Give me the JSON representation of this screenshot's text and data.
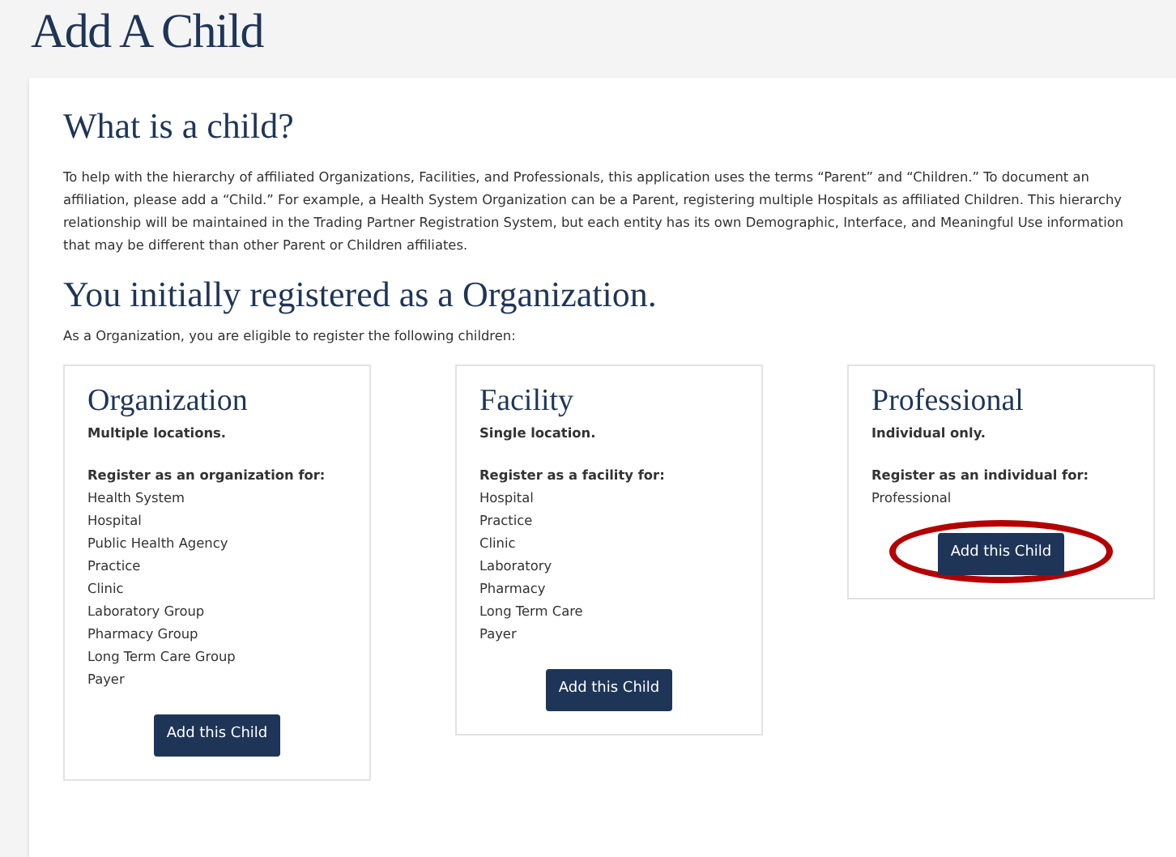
{
  "page_title": "Add A Child",
  "intro": {
    "heading": "What is a child?",
    "text": "To help with the hierarchy of affiliated Organizations, Facilities, and Professionals, this application uses the terms “Parent” and “Children.” To document an affiliation, please add a “Child.” For example, a Health System Organization can be a Parent, registering multiple Hospitals as affiliated Children. This hierarchy relationship will be maintained in the Trading Partner Registration System, but each entity has its own Demographic, Interface, and Meaningful Use information that may be different than other Parent or Children affiliates."
  },
  "registered": {
    "heading": "You initially registered as a Organization.",
    "text": "As a Organization, you are eligible to register the following children:"
  },
  "cards": [
    {
      "title": "Organization",
      "subtitle": "Multiple locations.",
      "register_label": "Register as an organization for:",
      "items": [
        "Health System",
        "Hospital",
        "Public Health Agency",
        "Practice",
        "Clinic",
        "Laboratory Group",
        "Pharmacy Group",
        "Long Term Care Group",
        "Payer"
      ],
      "button": "Add this Child",
      "highlighted": false
    },
    {
      "title": "Facility",
      "subtitle": "Single location.",
      "register_label": "Register as a facility for:",
      "items": [
        "Hospital",
        "Practice",
        "Clinic",
        "Laboratory",
        "Pharmacy",
        "Long Term Care",
        "Payer"
      ],
      "button": "Add this Child",
      "highlighted": false
    },
    {
      "title": "Professional",
      "subtitle": "Individual only.",
      "register_label": "Register as an individual for:",
      "items": [
        "Professional"
      ],
      "button": "Add this Child",
      "highlighted": true
    }
  ]
}
